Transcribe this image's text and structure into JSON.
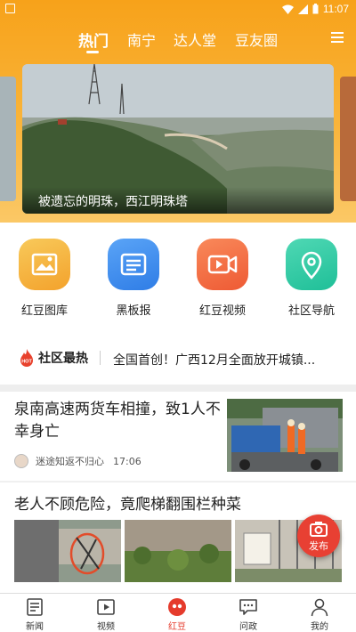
{
  "status_bar": {
    "time": "11:07"
  },
  "top_tabs": [
    {
      "label": "热门",
      "active": true
    },
    {
      "label": "南宁",
      "active": false
    },
    {
      "label": "达人堂",
      "active": false
    },
    {
      "label": "豆友圈",
      "active": false
    }
  ],
  "banner": {
    "caption": "被遗忘的明珠，西江明珠塔"
  },
  "quick_nav": [
    {
      "label": "红豆图库",
      "icon": "image-icon",
      "color": "#f6b23c"
    },
    {
      "label": "黑板报",
      "icon": "board-icon",
      "color": "#3d8ef0"
    },
    {
      "label": "红豆视频",
      "icon": "video-icon",
      "color": "#f46a3e"
    },
    {
      "label": "社区导航",
      "icon": "location-icon",
      "color": "#29c7a1"
    }
  ],
  "hot_bar": {
    "badge": "HOT",
    "title": "社区最热",
    "text": "全国首创！广西12月全面放开城镇..."
  },
  "articles": [
    {
      "title": "泉南高速两货车相撞，致1人不幸身亡",
      "author": "迷途知返不归心",
      "time": "17:06"
    },
    {
      "title": "老人不顾危险，竟爬梯翻围栏种菜"
    }
  ],
  "publish_button": {
    "label": "发布"
  },
  "bottom_nav": [
    {
      "label": "新闻",
      "icon": "news-icon",
      "active": false
    },
    {
      "label": "视频",
      "icon": "video-play-icon",
      "active": false
    },
    {
      "label": "红豆",
      "icon": "hongdou-icon",
      "active": true
    },
    {
      "label": "问政",
      "icon": "chat-icon",
      "active": false
    },
    {
      "label": "我的",
      "icon": "user-icon",
      "active": false
    }
  ],
  "colors": {
    "header": "#f7a21a",
    "accent_red": "#e53b2c"
  }
}
